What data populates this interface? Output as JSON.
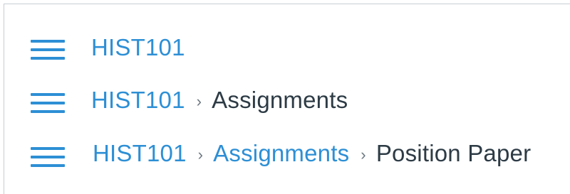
{
  "breadcrumb_rows": [
    {
      "course": "HIST101"
    },
    {
      "course": "HIST101",
      "separator": "›",
      "current": "Assignments"
    },
    {
      "course": "HIST101",
      "separator_1": "›",
      "section": "Assignments",
      "separator_2": "›",
      "current": "Position Paper"
    }
  ],
  "colors": {
    "link": "#2d8fd5",
    "text": "#2d3b45",
    "separator": "#6b7780",
    "border": "#c7cdd1"
  },
  "icons": {
    "menu": "hamburger-menu-icon"
  }
}
